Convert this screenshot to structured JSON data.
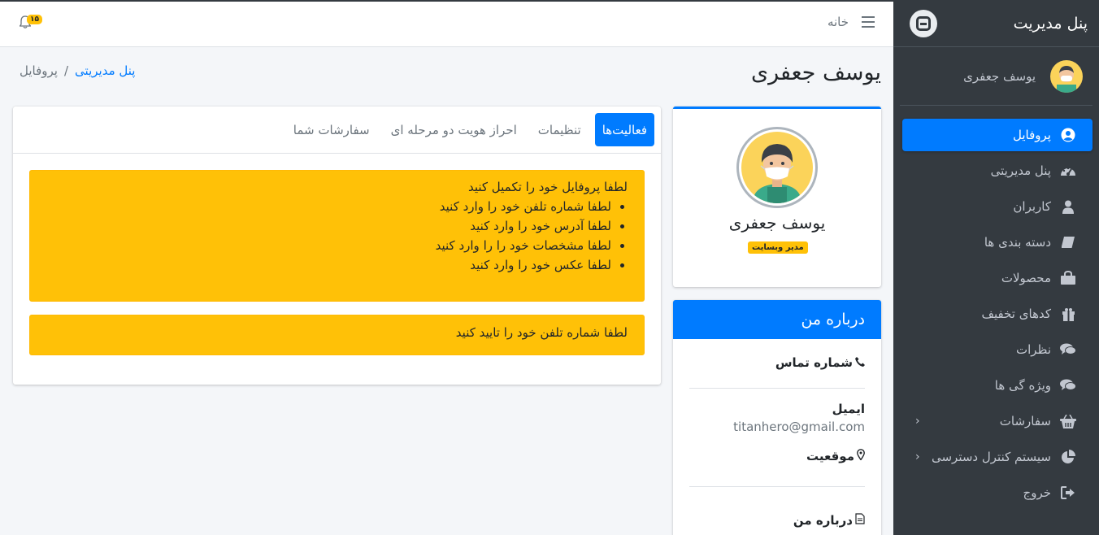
{
  "sidebar": {
    "brand_title": "پنل مدیریت",
    "user_name": "یوسف جعفری",
    "items": [
      {
        "label": "پروفایل",
        "icon": "user-circle-icon",
        "active": true
      },
      {
        "label": "پنل مدیریتی",
        "icon": "dashboard-icon"
      },
      {
        "label": "کاربران",
        "icon": "user-icon"
      },
      {
        "label": "دسته بندی ها",
        "icon": "book-icon"
      },
      {
        "label": "محصولات",
        "icon": "shopping-bag-icon"
      },
      {
        "label": "کدهای تخفیف",
        "icon": "gift-icon"
      },
      {
        "label": "نظرات",
        "icon": "comments-icon"
      },
      {
        "label": "ویژه گی ها",
        "icon": "comments-icon"
      },
      {
        "label": "سفارشات",
        "icon": "shopping-basket-icon",
        "has_submenu": true
      },
      {
        "label": "سیستم کنترل دسترسی",
        "icon": "chart-pie-icon",
        "has_submenu": true
      },
      {
        "label": "خروج",
        "icon": "sign-out-icon"
      }
    ]
  },
  "navbar": {
    "home_label": "خانه",
    "notification_count": "۱۵"
  },
  "header": {
    "page_title": "یوسف جعفری",
    "breadcrumb": {
      "link": "پنل مدیریتی",
      "separator": "/",
      "active": "پروفایل"
    }
  },
  "profile": {
    "name": "یوسف جعفری",
    "role": "مدیر وبسایت"
  },
  "about": {
    "title": "درباره من",
    "phone_label": "شماره تماس",
    "email_label": "ایمیل",
    "email_value": "titanhero@gmail.com",
    "location_label": "موقعیت",
    "about_label": "درباره من"
  },
  "tabs": [
    {
      "label": "فعالیت‌ها",
      "active": true
    },
    {
      "label": "تنظیمات"
    },
    {
      "label": "احراز هویت دو مرحله ای"
    },
    {
      "label": "سفارشات شما"
    }
  ],
  "alerts": {
    "profile_title": "لطفا پروفایل خود را تکمیل کنید",
    "profile_items": [
      "لطفا شماره تلفن خود را وارد کنید",
      "لطفا آدرس خود را وارد کنید",
      "لطفا مشخصات خود را را وارد کنید",
      "لطفا عکس خود را وارد کنید"
    ],
    "phone_verify": "لطفا شماره تلفن خود را تایید کنید"
  },
  "colors": {
    "primary": "#007bff",
    "warning": "#ffc107",
    "sidebar": "#343a40"
  }
}
